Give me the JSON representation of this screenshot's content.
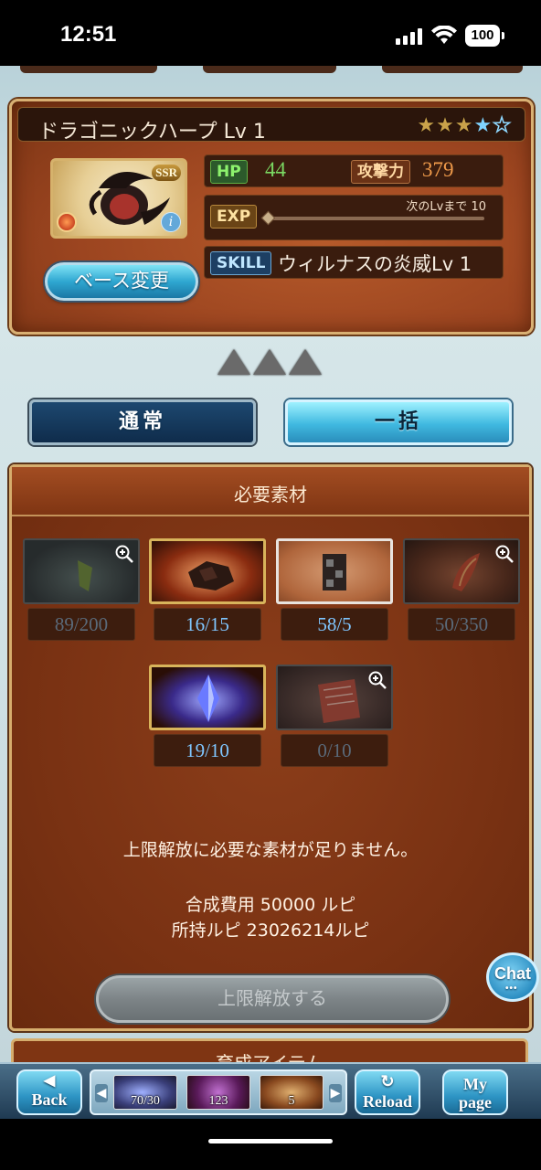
{
  "status_bar": {
    "time": "12:51",
    "battery": "100"
  },
  "weapon": {
    "name": "ドラゴニックハープ  Lv 1",
    "rarity_badge": "SSR",
    "stars": {
      "filled": 3,
      "blue": 1,
      "empty": 1
    },
    "hp_label": "HP",
    "hp": "44",
    "atk_label": "攻撃力",
    "atk": "379",
    "exp_label": "EXP",
    "exp_next_text": "次のLvまで  10",
    "skill_label": "SKILL",
    "skill_name": "ウィルナスの炎威Lv 1",
    "base_change_button": "ベース変更",
    "uncap_level": 3
  },
  "mode_buttons": {
    "normal": "通常",
    "bulk": "一括"
  },
  "materials": {
    "title": "必要素材",
    "items": [
      {
        "count": "89/200",
        "sufficient": false,
        "zoom": true
      },
      {
        "count": "16/15",
        "sufficient": true,
        "zoom": false
      },
      {
        "count": "58/5",
        "sufficient": true,
        "zoom": false
      },
      {
        "count": "50/350",
        "sufficient": false,
        "zoom": true
      },
      {
        "count": "19/10",
        "sufficient": true,
        "zoom": false
      },
      {
        "count": "0/10",
        "sufficient": false,
        "zoom": true
      }
    ],
    "message": "上限解放に必要な素材が足りません。",
    "cost_line": "合成費用  50000 ルピ",
    "owned_line": "所持ルピ  23026214ルピ",
    "uncap_button": "上限解放する"
  },
  "chat_button": "Chat",
  "next_panel_title": "育成アイテム",
  "bottom_nav": {
    "back": "Back",
    "reload": "Reload",
    "mypage_line1": "My",
    "mypage_line2": "page",
    "strip_items": [
      {
        "count": "70/30"
      },
      {
        "count": "123"
      },
      {
        "count": "5"
      }
    ]
  },
  "colors": {
    "panel_brown": "#8c3e1a",
    "accent_blue": "#2fa7d1",
    "gold_border": "#d6ad6d"
  }
}
